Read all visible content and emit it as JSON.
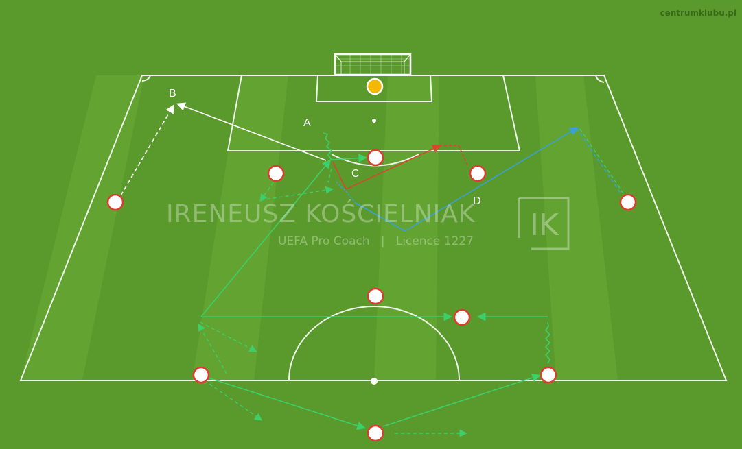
{
  "site": "centrumklubu.pl",
  "watermark": {
    "name": "IRENEUSZ KOŚCIELNIAK",
    "subtitle": "UEFA Pro Coach   |   Licence 1227",
    "logo_letters": "IK"
  },
  "labels": {
    "A": "A",
    "B": "B",
    "C": "C",
    "D": "D"
  },
  "colors": {
    "grass_light": "#62a431",
    "grass_dark": "#569a28",
    "line": "#ffffff",
    "player_fill": "#ffffff",
    "player_ring": "#e03a2e",
    "goalkeeper": "#f5b800",
    "pass_green": "#3ccf6a",
    "run_white": "#ffffff",
    "run_red": "#d9452e",
    "run_blue": "#3aa0d8"
  },
  "players": [
    {
      "id": "cb-left",
      "role": "player"
    },
    {
      "id": "cb-right",
      "role": "player"
    },
    {
      "id": "fullback-left",
      "role": "player"
    },
    {
      "id": "fullback-right",
      "role": "player"
    },
    {
      "id": "mid-center",
      "role": "player"
    },
    {
      "id": "mid-right",
      "role": "player"
    },
    {
      "id": "wing-left",
      "role": "player"
    },
    {
      "id": "inside-left",
      "role": "player"
    },
    {
      "id": "striker",
      "role": "player"
    },
    {
      "id": "inside-right",
      "role": "player"
    },
    {
      "id": "wing-right",
      "role": "player"
    },
    {
      "id": "goalkeeper",
      "role": "goalkeeper"
    }
  ]
}
